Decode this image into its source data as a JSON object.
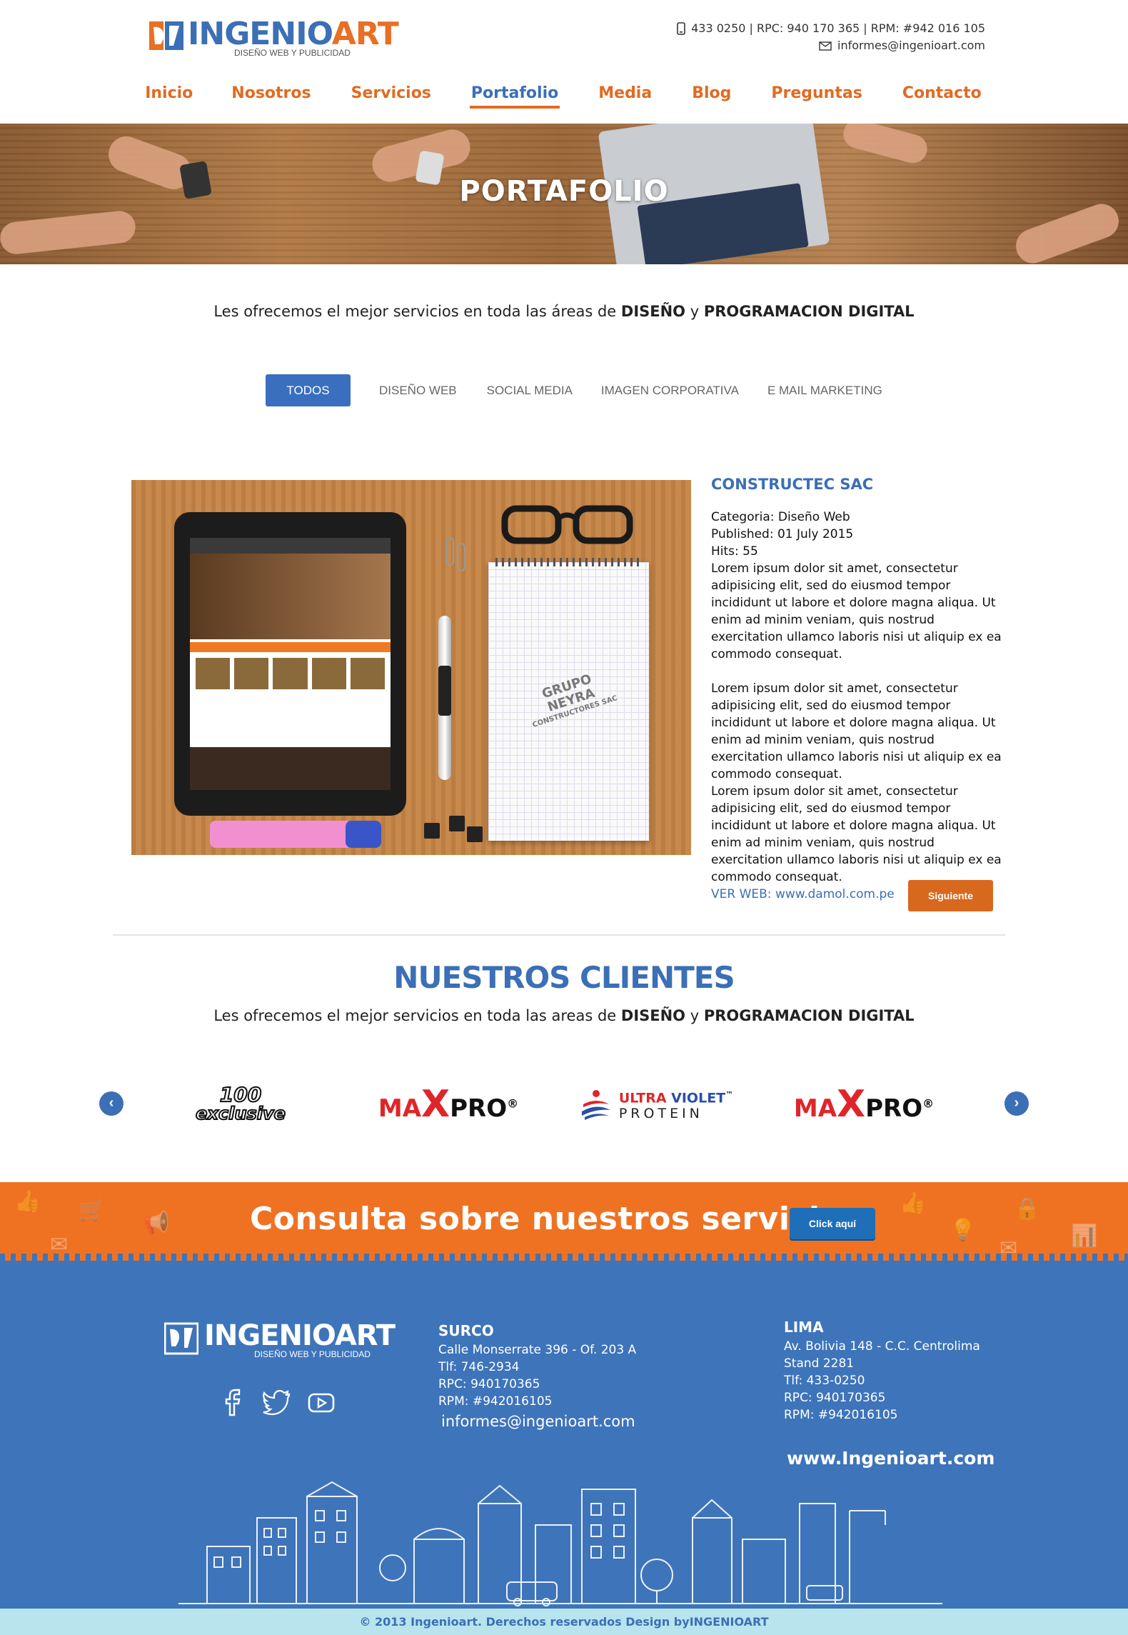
{
  "brand": {
    "name_part1": "INGENIO",
    "name_part2": "ART",
    "tagline": "DISEÑO WEB Y PUBLICIDAD",
    "primary_color": "#3b6fb6",
    "accent_color": "#e86f24"
  },
  "header": {
    "phones": "433 0250 | RPC: 940 170 365 | RPM: #942 016 105",
    "email": "informes@ingenioart.com",
    "phone_icon": "phone-icon",
    "mail_icon": "mail-icon"
  },
  "nav": {
    "items": [
      {
        "label": "Inicio",
        "active": false
      },
      {
        "label": "Nosotros",
        "active": false
      },
      {
        "label": "Servicios",
        "active": false
      },
      {
        "label": "Portafolio",
        "active": true
      },
      {
        "label": "Media",
        "active": false
      },
      {
        "label": "Blog",
        "active": false
      },
      {
        "label": "Preguntas",
        "active": false
      },
      {
        "label": "Contacto",
        "active": false
      }
    ]
  },
  "hero": {
    "title": "PORTAFOLIO"
  },
  "intro": {
    "text_before": "Les ofrecemos el mejor servicios en toda las áreas de ",
    "bold1": "DISEÑO",
    "text_mid": " y ",
    "bold2": "PROGRAMACION DIGITAL"
  },
  "filters": {
    "items": [
      {
        "label": "TODOS",
        "active": true
      },
      {
        "label": "DISEÑO WEB",
        "active": false
      },
      {
        "label": "SOCIAL MEDIA",
        "active": false
      },
      {
        "label": "IMAGEN CORPORATIVA",
        "active": false
      },
      {
        "label": "E MAIL MARKETING",
        "active": false
      }
    ]
  },
  "portfolio_item": {
    "title": "CONSTRUCTEC SAC",
    "category": "Categoria: Diseño Web",
    "published": "Published: 01 July 2015",
    "hits": "Hits: 55",
    "para1": "Lorem ipsum dolor sit amet, consectetur adipisicing elit, sed do eiusmod tempor incididunt ut labore et dolore magna aliqua. Ut enim ad minim veniam, quis nostrud exercitation ullamco laboris nisi ut aliquip ex ea commodo consequat.",
    "para2": "Lorem ipsum dolor sit amet, consectetur adipisicing elit, sed do eiusmod tempor incididunt ut labore et dolore magna aliqua. Ut enim ad minim veniam, quis nostrud exercitation ullamco laboris nisi ut aliquip ex ea commodo consequat.",
    "para3": "Lorem ipsum dolor sit amet, consectetur adipisicing elit, sed do eiusmod tempor incididunt ut labore et dolore magna aliqua. Ut enim ad minim veniam, quis nostrud exercitation ullamco laboris nisi ut aliquip ex ea commodo consequat.",
    "link_prefix": "VER WEB: ",
    "link_url": "www.damol.com.pe",
    "image_stamp_line1": "GRUPO",
    "image_stamp_line2": "NEYRA",
    "image_stamp_line3": "CONSTRUCTORES SAC",
    "next_label": "Siguiente"
  },
  "clients": {
    "title": "NUESTROS CLIENTES",
    "sub_before": "Les ofrecemos el mejor servicios en toda las areas de ",
    "bold1": "DISEÑO",
    "sub_mid": " y ",
    "bold2": "PROGRAMACION DIGITAL",
    "prev_icon": "chevron-left-icon",
    "next_icon": "chevron-right-icon",
    "logos": [
      {
        "top": "100",
        "bottom": "exclusive"
      },
      {
        "ma": "MA",
        "x": "X",
        "pro": "PRO",
        "mark": "®"
      },
      {
        "line1a": "ULTRA",
        "line1b": "VIOLET",
        "line2": "PROTEIN",
        "mark": "™"
      },
      {
        "ma": "MA",
        "x": "X",
        "pro": "PRO",
        "mark": "®"
      }
    ]
  },
  "cta": {
    "text": "Consulta sobre nuestros servicios",
    "button": "Click aquí"
  },
  "footer": {
    "surco": {
      "title": "SURCO",
      "line1": "Calle Monserrate 396 - Of. 203 A",
      "line2": "Tlf: 746-2934",
      "line3": "RPC: 940170365",
      "line4": "RPM: #942016105",
      "email": "informes@ingenioart.com"
    },
    "lima": {
      "title": "LIMA",
      "line1": "Av. Bolivia 148 - C.C. Centrolima",
      "line2": "Stand 2281",
      "line3": "Tlf: 433-0250",
      "line4": "RPC: 940170365",
      "line5": "RPM: #942016105"
    },
    "website": "www.Ingenioart.com",
    "social": [
      "facebook-icon",
      "twitter-icon",
      "youtube-icon"
    ],
    "copyright": "© 2013 Ingenioart. Derechos reservados Design byINGENIOART"
  }
}
